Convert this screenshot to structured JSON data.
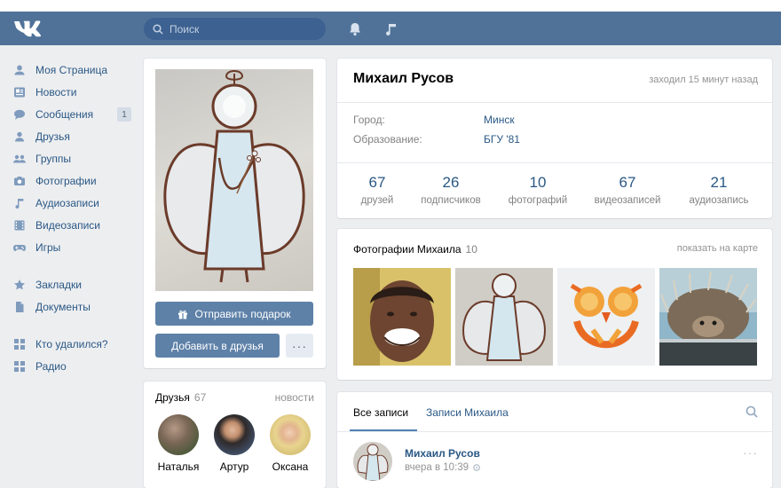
{
  "search": {
    "placeholder": "Поиск"
  },
  "sidebar": {
    "items": [
      {
        "label": "Моя Страница",
        "icon": "user-icon"
      },
      {
        "label": "Новости",
        "icon": "news-icon"
      },
      {
        "label": "Сообщения",
        "icon": "messages-icon",
        "badge": "1"
      },
      {
        "label": "Друзья",
        "icon": "friends-icon"
      },
      {
        "label": "Группы",
        "icon": "groups-icon"
      },
      {
        "label": "Фотографии",
        "icon": "camera-icon"
      },
      {
        "label": "Аудиозаписи",
        "icon": "music-icon"
      },
      {
        "label": "Видеозаписи",
        "icon": "video-icon"
      },
      {
        "label": "Игры",
        "icon": "gamepad-icon"
      },
      {
        "label": "Закладки",
        "icon": "star-icon"
      },
      {
        "label": "Документы",
        "icon": "document-icon"
      },
      {
        "label": "Кто удалился?",
        "icon": "apps-icon"
      },
      {
        "label": "Радио",
        "icon": "apps-icon"
      }
    ]
  },
  "avatar": {
    "gift_label": "Отправить подарок",
    "add_friend_label": "Добавить в друзья",
    "more_label": "···"
  },
  "friends": {
    "title": "Друзья",
    "count": "67",
    "news_label": "новости",
    "items": [
      {
        "name": "Наталья"
      },
      {
        "name": "Артур"
      },
      {
        "name": "Оксана"
      }
    ]
  },
  "profile": {
    "name": "Михаил Русов",
    "last_seen": "заходил 15 минут назад",
    "city_label": "Город:",
    "city_value": "Минск",
    "education_label": "Образование:",
    "education_value": "БГУ '81",
    "counters": [
      {
        "value": "67",
        "label": "друзей"
      },
      {
        "value": "26",
        "label": "подписчиков"
      },
      {
        "value": "10",
        "label": "фотографий"
      },
      {
        "value": "67",
        "label": "видеозаписей"
      },
      {
        "value": "21",
        "label": "аудиозапись"
      }
    ]
  },
  "photos": {
    "title": "Фотографии Михаила",
    "count": "10",
    "map_link": "показать на карте"
  },
  "wall": {
    "tab_all": "Все записи",
    "tab_own": "Записи Михаила",
    "post": {
      "author": "Михаил Русов",
      "time": "вчера в 10:39",
      "more": "···"
    }
  },
  "colors": {
    "header": "#507299",
    "link": "#2a5885",
    "button": "#5e81a8",
    "background": "#edeef0"
  }
}
